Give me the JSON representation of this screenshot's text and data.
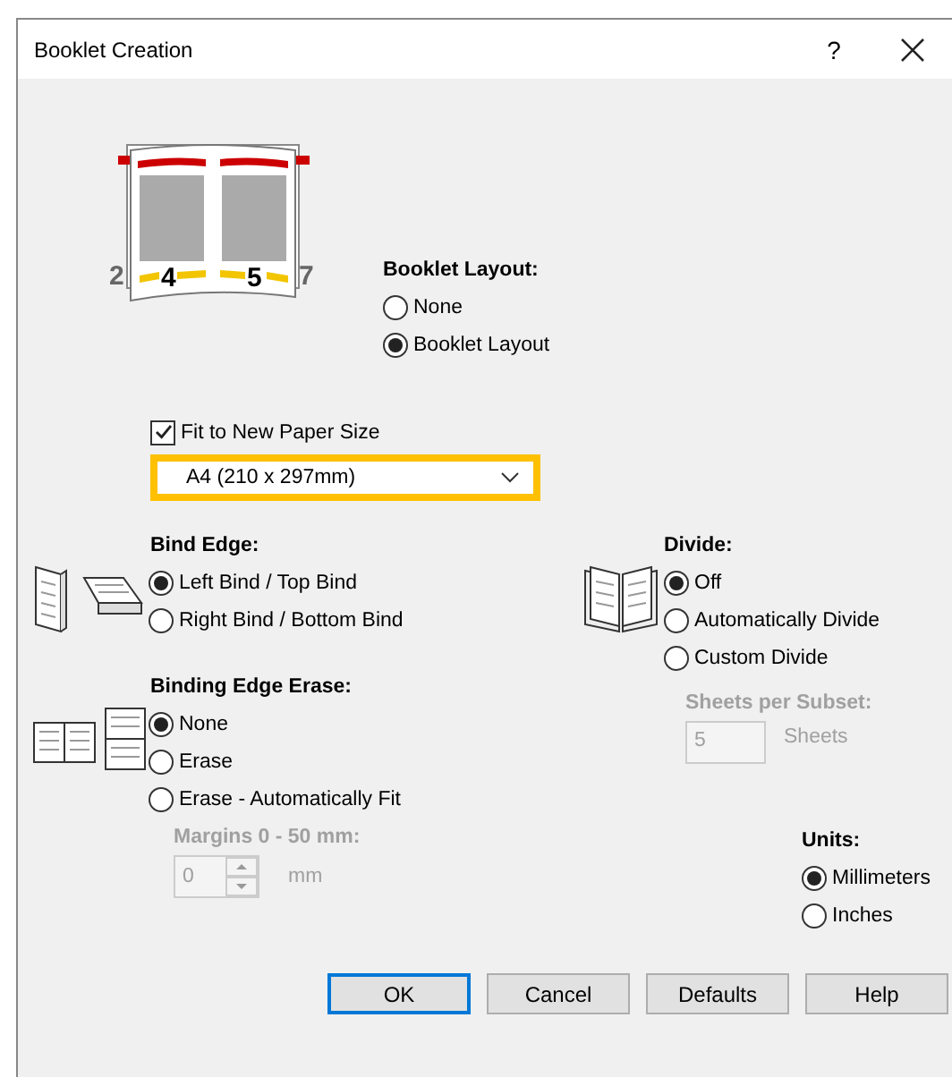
{
  "window": {
    "title": "Booklet Creation",
    "help_button": "?"
  },
  "illustration": {
    "page_numbers": [
      "2",
      "4",
      "5",
      "7"
    ]
  },
  "booklet_layout": {
    "label": "Booklet Layout:",
    "options": [
      {
        "label": "None",
        "selected": false
      },
      {
        "label": "Booklet Layout",
        "selected": true
      }
    ]
  },
  "fit_to_paper": {
    "label": "Fit to New Paper Size",
    "checked": true
  },
  "paper_size": {
    "value": "A4 (210 x 297mm)",
    "highlighted": true
  },
  "bind_edge": {
    "label": "Bind Edge:",
    "options": [
      {
        "label": "Left Bind / Top Bind",
        "selected": true
      },
      {
        "label": "Right Bind / Bottom Bind",
        "selected": false
      }
    ]
  },
  "divide": {
    "label": "Divide:",
    "options": [
      {
        "label": "Off",
        "selected": true
      },
      {
        "label": "Automatically Divide",
        "selected": false
      },
      {
        "label": "Custom Divide",
        "selected": false
      }
    ]
  },
  "sheets_per_subset": {
    "label": "Sheets per Subset:",
    "value": "5",
    "unit": "Sheets",
    "disabled": true
  },
  "binding_edge_erase": {
    "label": "Binding Edge Erase:",
    "options": [
      {
        "label": "None",
        "selected": true
      },
      {
        "label": "Erase",
        "selected": false
      },
      {
        "label": "Erase - Automatically Fit",
        "selected": false
      }
    ]
  },
  "margins": {
    "label": "Margins 0 - 50 mm:",
    "value": "0",
    "unit": "mm",
    "disabled": true
  },
  "units": {
    "label": "Units:",
    "options": [
      {
        "label": "Millimeters",
        "selected": true
      },
      {
        "label": "Inches",
        "selected": false
      }
    ]
  },
  "buttons": [
    {
      "label": "OK",
      "default": true
    },
    {
      "label": "Cancel",
      "default": false
    },
    {
      "label": "Defaults",
      "default": false
    },
    {
      "label": "Help",
      "default": false
    }
  ]
}
